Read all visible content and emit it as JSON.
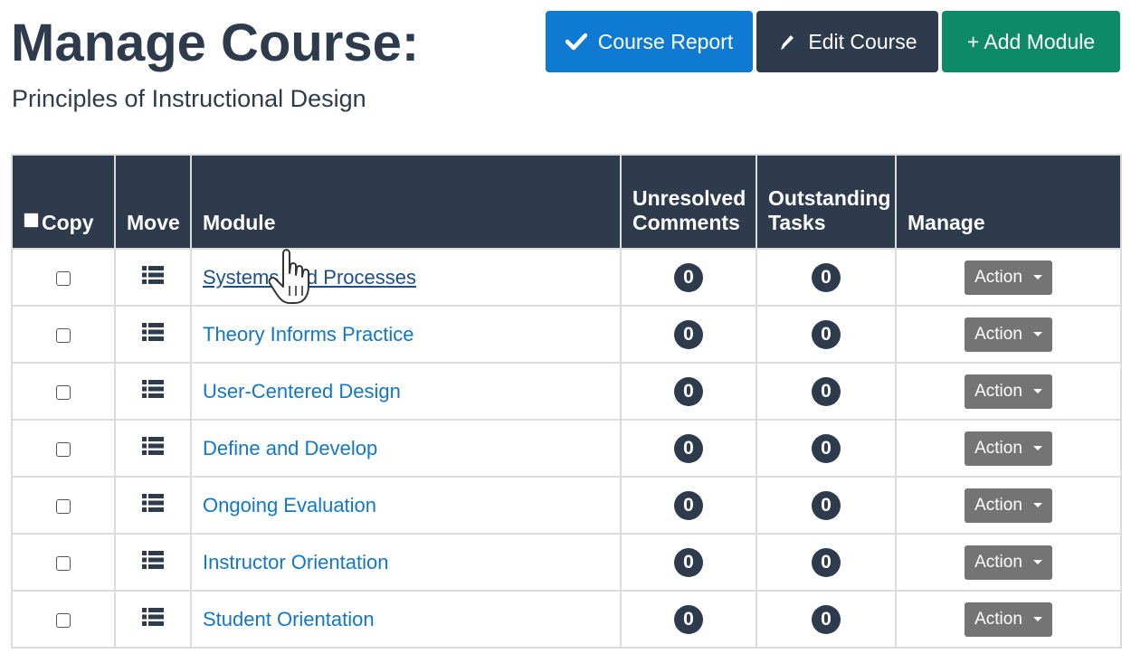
{
  "header": {
    "title": "Manage Course:",
    "subtitle": "Principles of Instructional Design"
  },
  "toolbar": {
    "course_report": "Course Report",
    "edit_course": "Edit Course",
    "add_module": "+ Add Module"
  },
  "table": {
    "columns": {
      "copy": "Copy",
      "move": "Move",
      "module": "Module",
      "unresolved": "Unresolved Comments",
      "outstanding": "Outstanding Tasks",
      "manage": "Manage"
    },
    "rows": [
      {
        "module": "Systems and Processes",
        "unresolved": "0",
        "outstanding": "0",
        "action": "Action"
      },
      {
        "module": "Theory Informs Practice",
        "unresolved": "0",
        "outstanding": "0",
        "action": "Action"
      },
      {
        "module": "User-Centered Design",
        "unresolved": "0",
        "outstanding": "0",
        "action": "Action"
      },
      {
        "module": "Define and Develop",
        "unresolved": "0",
        "outstanding": "0",
        "action": "Action"
      },
      {
        "module": "Ongoing Evaluation",
        "unresolved": "0",
        "outstanding": "0",
        "action": "Action"
      },
      {
        "module": "Instructor Orientation",
        "unresolved": "0",
        "outstanding": "0",
        "action": "Action"
      },
      {
        "module": "Student Orientation",
        "unresolved": "0",
        "outstanding": "0",
        "action": "Action"
      }
    ]
  },
  "colors": {
    "header_bg": "#2d3b4d",
    "report_button": "#0f7ad1",
    "edit_button": "#2d3b4d",
    "add_button": "#0d8a66",
    "link": "#1177c8",
    "action_button": "#747474"
  },
  "icons": [
    "checkmark-icon",
    "pencil-icon",
    "list-icon",
    "caret-down-icon",
    "hand-cursor-icon"
  ]
}
